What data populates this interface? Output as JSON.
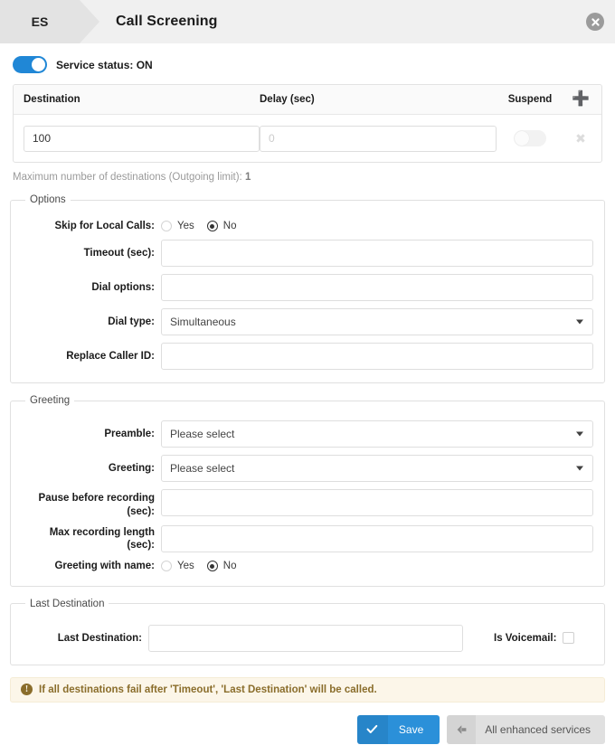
{
  "header": {
    "breadcrumb_code": "ES",
    "title": "Call Screening",
    "close_icon": "close-circle-icon"
  },
  "service_status": {
    "label": "Service status: ON",
    "state": "ON",
    "accent_color": "#2087d6"
  },
  "destinations_table": {
    "columns": [
      "Destination",
      "Delay (sec)",
      "Suspend"
    ],
    "add_icon": "plus-icon",
    "rows": [
      {
        "destination_value": "100",
        "delay_value": "",
        "delay_placeholder": "0",
        "suspend": false,
        "remove_icon": "x-icon"
      }
    ],
    "max_note_text": "Maximum number of destinations (Outgoing limit):",
    "max_note_value": "1"
  },
  "options": {
    "legend": "Options",
    "skip_local_calls": {
      "label": "Skip for Local Calls:",
      "options": [
        "Yes",
        "No"
      ],
      "selected": "No"
    },
    "timeout": {
      "label": "Timeout (sec):",
      "value": ""
    },
    "dial_options": {
      "label": "Dial options:",
      "value": ""
    },
    "dial_type": {
      "label": "Dial type:",
      "value": "Simultaneous"
    },
    "replace_caller_id": {
      "label": "Replace Caller ID:",
      "value": ""
    }
  },
  "greeting": {
    "legend": "Greeting",
    "preamble": {
      "label": "Preamble:",
      "value": "Please select"
    },
    "greeting_select": {
      "label": "Greeting:",
      "value": "Please select"
    },
    "pause_before_recording": {
      "label_line1": "Pause before recording",
      "label_line2": "(sec):",
      "value": ""
    },
    "max_recording_length": {
      "label": "Max recording length (sec):",
      "value": ""
    },
    "greeting_with_name": {
      "label": "Greeting with name:",
      "options": [
        "Yes",
        "No"
      ],
      "selected": "No"
    }
  },
  "last_destination": {
    "legend": "Last Destination",
    "field_label": "Last Destination:",
    "field_value": "",
    "is_voicemail_label": "Is Voicemail:",
    "is_voicemail_checked": false
  },
  "alert": {
    "icon": "exclamation-circle-icon",
    "text": "If all destinations fail after 'Timeout', 'Last Destination' will be called.",
    "color": "#8a6d2b",
    "background": "#fcf6e9"
  },
  "footer": {
    "save_label": "Save",
    "save_icon": "check-icon",
    "save_color": "#2b90d9",
    "back_label": "All enhanced services",
    "back_icon": "arrow-left-icon"
  }
}
